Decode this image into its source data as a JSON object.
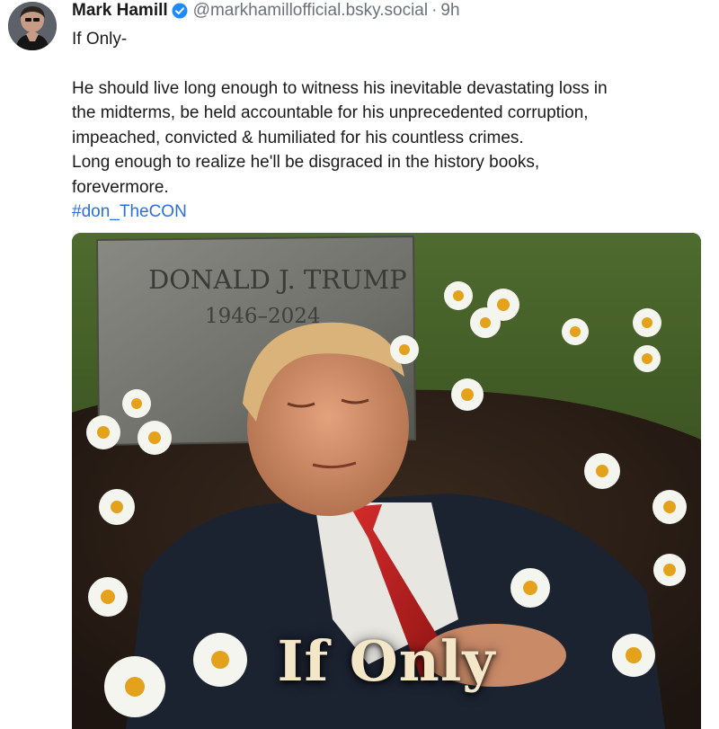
{
  "post": {
    "author_name": "Mark Hamill",
    "handle": "@markhamillofficial.bsky.social",
    "separator": "·",
    "timestamp": "9h",
    "verified_icon": "verified-badge-icon",
    "lines": [
      "If Only-",
      "",
      "He should live long enough to witness his inevitable devastating loss in",
      "the midterms, be held accountable for his unprecedented corruption,",
      "impeached, convicted & humiliated for his countless crimes.",
      "Long enough to realize he'll be disgraced in the history books,",
      "forevermore."
    ],
    "hashtag": "#don_TheCON",
    "image": {
      "headstone_name": "DONALD J. TRUMP",
      "headstone_dates": "1946–2024",
      "caption": "If Only"
    }
  },
  "colors": {
    "link": "#2a6fdb",
    "verified": "#1d8cf8",
    "muted_text": "#6b7178"
  }
}
